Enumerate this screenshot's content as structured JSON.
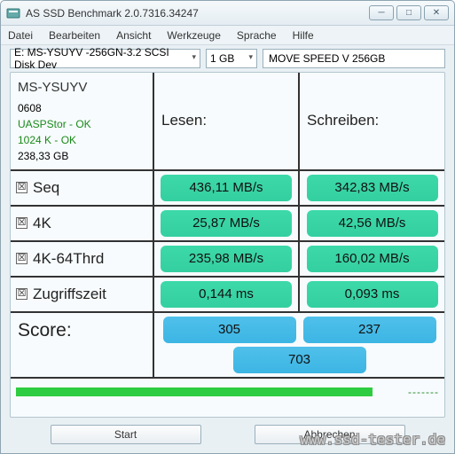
{
  "window": {
    "title": "AS SSD Benchmark 2.0.7316.34247"
  },
  "menu": {
    "file": "Datei",
    "edit": "Bearbeiten",
    "view": "Ansicht",
    "tools": "Werkzeuge",
    "language": "Sprache",
    "help": "Hilfe"
  },
  "toolbar": {
    "device": "E: MS-YSUYV -256GN-3.2 SCSI Disk Dev",
    "size": "1 GB",
    "name": "MOVE SPEED V 256GB"
  },
  "info": {
    "model": "MS-YSUYV",
    "fw": "0608",
    "driver": "UASPStor - OK",
    "align": "1024 K - OK",
    "capacity": "238,33 GB"
  },
  "headers": {
    "read": "Lesen:",
    "write": "Schreiben:"
  },
  "rows": {
    "seq": {
      "label": "Seq",
      "read": "436,11 MB/s",
      "write": "342,83 MB/s",
      "checked": "☒"
    },
    "k4": {
      "label": "4K",
      "read": "25,87 MB/s",
      "write": "42,56 MB/s",
      "checked": "☒"
    },
    "k4t": {
      "label": "4K-64Thrd",
      "read": "235,98 MB/s",
      "write": "160,02 MB/s",
      "checked": "☒"
    },
    "acc": {
      "label": "Zugriffszeit",
      "read": "0,144 ms",
      "write": "0,093 ms",
      "checked": "☒"
    }
  },
  "score": {
    "label": "Score:",
    "read": "305",
    "write": "237",
    "total": "703"
  },
  "buttons": {
    "start": "Start",
    "abort": "Abbrechen"
  },
  "watermark": "www.ssd-tester.de"
}
